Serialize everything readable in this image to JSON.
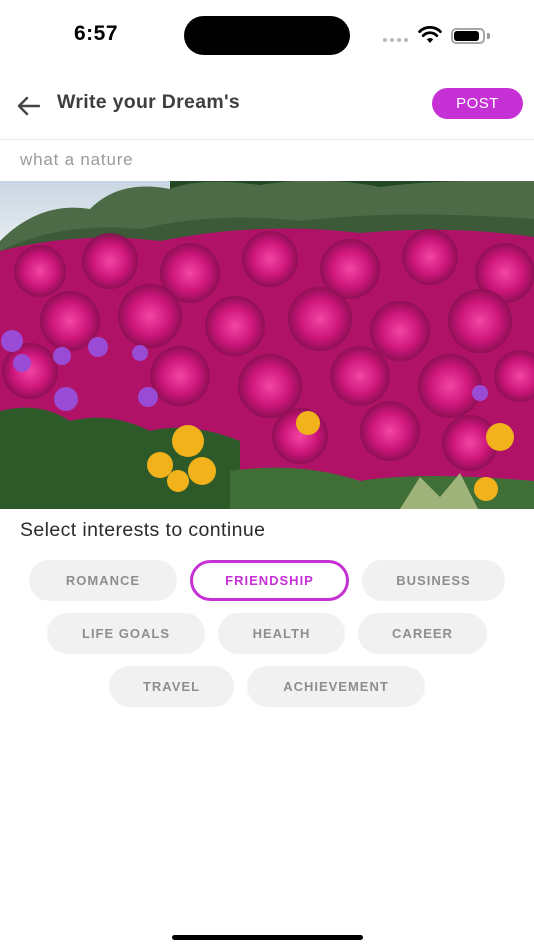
{
  "status_bar": {
    "time": "6:57",
    "icons": [
      "signal-icon",
      "wifi-icon",
      "battery-icon"
    ]
  },
  "header": {
    "title": "Write your Dream's",
    "post_label": "POST",
    "back_icon": "arrow-left-icon"
  },
  "caption": {
    "value": "what a nature"
  },
  "photo": {
    "subject": "pink and purple daisy flowers with yellow blooms"
  },
  "interests": {
    "title": "Select interests to continue",
    "chips": [
      {
        "label": "ROMANCE",
        "selected": false
      },
      {
        "label": "FRIENDSHIP",
        "selected": true
      },
      {
        "label": "BUSINESS",
        "selected": false
      },
      {
        "label": "LIFE GOALS",
        "selected": false
      },
      {
        "label": "HEALTH",
        "selected": false
      },
      {
        "label": "CAREER",
        "selected": false
      },
      {
        "label": "TRAVEL",
        "selected": false
      },
      {
        "label": "ACHIEVEMENT",
        "selected": false
      }
    ]
  },
  "colors": {
    "accent": "#c531d4",
    "chip_bg": "#f1f1f1",
    "chip_text": "#8e8e8e"
  }
}
